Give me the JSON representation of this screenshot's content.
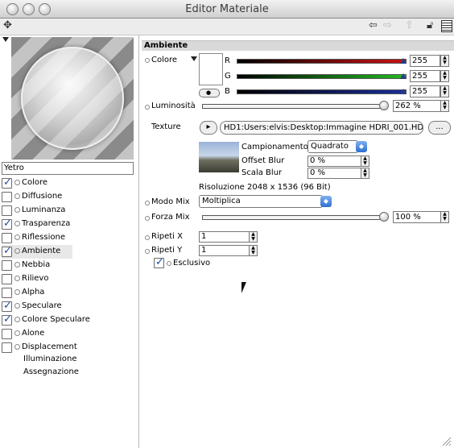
{
  "window": {
    "title": "Editor Materiale"
  },
  "material": {
    "name": "Yetro"
  },
  "channels": [
    {
      "label": "Colore",
      "checked": true
    },
    {
      "label": "Diffusione",
      "checked": false
    },
    {
      "label": "Luminanza",
      "checked": false
    },
    {
      "label": "Trasparenza",
      "checked": true
    },
    {
      "label": "Riflessione",
      "checked": false
    },
    {
      "label": "Ambiente",
      "checked": true,
      "selected": true
    },
    {
      "label": "Nebbia",
      "checked": false
    },
    {
      "label": "Rilievo",
      "checked": false
    },
    {
      "label": "Alpha",
      "checked": false
    },
    {
      "label": "Speculare",
      "checked": true
    },
    {
      "label": "Colore Speculare",
      "checked": true
    },
    {
      "label": "Alone",
      "checked": false
    },
    {
      "label": "Displacement",
      "checked": false
    }
  ],
  "extra_items": [
    "Illuminazione",
    "Assegnazione"
  ],
  "section": {
    "title": "Ambiente"
  },
  "color": {
    "label": "Colore",
    "r_label": "R",
    "g_label": "G",
    "b_label": "B",
    "r_value": "255",
    "g_value": "255",
    "b_value": "255",
    "r_fraction": 1.0,
    "g_fraction": 1.0,
    "b_fraction": 1.0,
    "swatch": "#ffffff"
  },
  "luminosity": {
    "label": "Luminosità",
    "value": "262 %",
    "fraction": 1.0
  },
  "texture": {
    "label": "Texture",
    "path": "HD1:Users:elvis:Desktop:Immagine HDRI_001.HD",
    "browse_label": "...",
    "sampling_label": "Campionamento",
    "sampling_value": "Quadrato",
    "offset_blur_label": "Offset Blur",
    "offset_blur_value": "0 %",
    "scale_blur_label": "Scala Blur",
    "scale_blur_value": "0 %",
    "resolution": "Risoluzione 2048 x 1536  (96 Bit)"
  },
  "mix_mode": {
    "label": "Modo Mix",
    "value": "Moltiplica"
  },
  "mix_strength": {
    "label": "Forza Mix",
    "value": "100 %",
    "fraction": 1.0
  },
  "repeat_x": {
    "label": "Ripeti X",
    "value": "1"
  },
  "repeat_y": {
    "label": "Ripeti Y",
    "value": "1"
  },
  "exclusive": {
    "label": "Esclusivo",
    "checked": true
  },
  "colors": {
    "red": "#cc1111",
    "green": "#22bb22",
    "blue": "#1a2f9a",
    "accent": "#3a74d6"
  }
}
